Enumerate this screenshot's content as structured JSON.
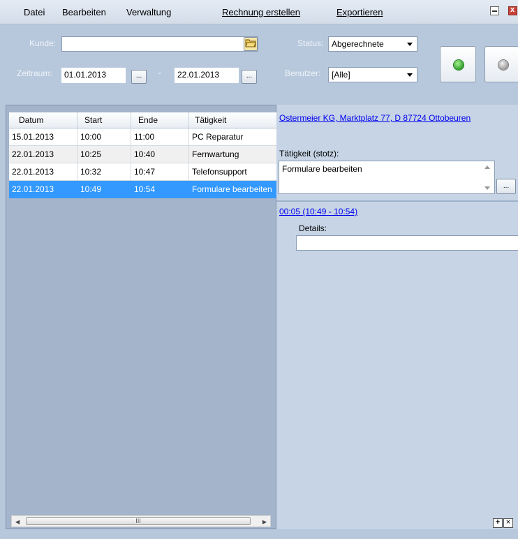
{
  "menu": {
    "datei": "Datei",
    "bearbeiten": "Bearbeiten",
    "verwaltung": "Verwaltung",
    "rechnung": "Rechnung erstellen",
    "exportieren": "Exportieren"
  },
  "filter": {
    "kunde_label": "Kunde:",
    "kunde_value": "",
    "zeitraum_label": "Zeitraum:",
    "date_from": "01.01.2013",
    "date_sep": "-",
    "date_to": "22.01.2013",
    "picker_label": "...",
    "status_label": "Status:",
    "status_value": "Abgerechnete",
    "benutzer_label": "Benutzer:",
    "benutzer_value": "[Alle]"
  },
  "table": {
    "columns": [
      "Datum",
      "Start",
      "Ende",
      "Tätigkeit"
    ],
    "rows": [
      [
        "15.01.2013",
        "10:00",
        "11:00",
        "PC Reparatur"
      ],
      [
        "22.01.2013",
        "10:25",
        "10:40",
        "Fernwartung"
      ],
      [
        "22.01.2013",
        "10:32",
        "10:47",
        "Telefonsupport"
      ],
      [
        "22.01.2013",
        "10:49",
        "10:54",
        "Formulare bearbeiten"
      ]
    ],
    "selected_row": 3
  },
  "detail": {
    "customer_link": "Ostermeier KG, Marktplatz 77, D 87724 Ottobeuren",
    "activity_label": "Tätigkeit (stotz):",
    "activity_value": "Formulare bearbeiten",
    "ellipsis": "...",
    "duration_link": "00:05 (10:49 - 10:54)",
    "details_label": "Details:",
    "details_value": ""
  },
  "scroll": {
    "thumb_glyph": "III"
  },
  "buttons": {
    "add": "+",
    "remove": "×"
  },
  "colors": {
    "accent_select": "#3399ff",
    "start_green": "#2ea02a"
  }
}
